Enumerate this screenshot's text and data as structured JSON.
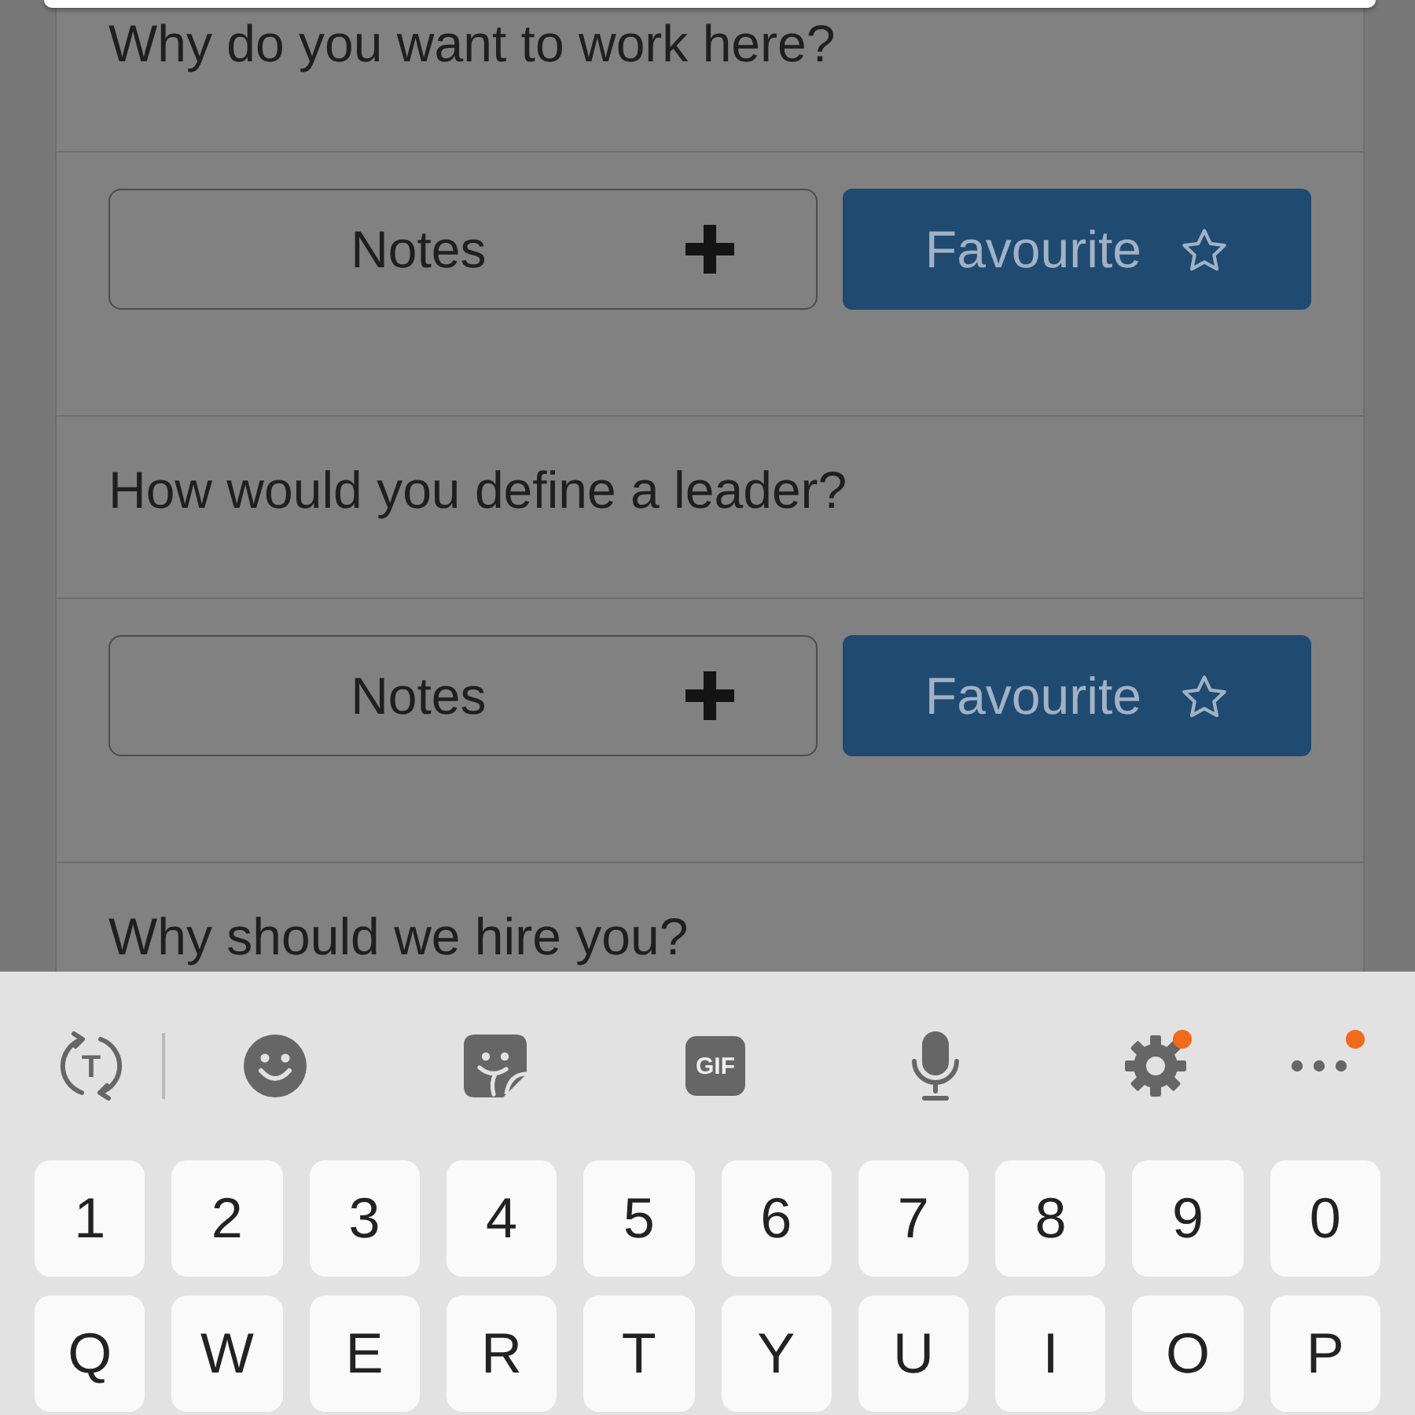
{
  "dialog": {
    "open": true
  },
  "questions": [
    {
      "text": "Why do you want to work here?",
      "notes_button": {
        "label": "Notes"
      },
      "favourite_button": {
        "label": "Favourite",
        "favourited": false
      }
    },
    {
      "text": "How would you define a leader?",
      "notes_button": {
        "label": "Notes"
      },
      "favourite_button": {
        "label": "Favourite",
        "favourited": false
      }
    },
    {
      "text": "Why should we hire you?"
    }
  ],
  "keyboard": {
    "toolbar": [
      {
        "kind": "translate",
        "label": "T",
        "badge": false
      },
      {
        "kind": "divider"
      },
      {
        "kind": "emoji",
        "badge": false
      },
      {
        "kind": "sticker",
        "badge": false
      },
      {
        "kind": "gif",
        "label": "GIF",
        "badge": false
      },
      {
        "kind": "mic",
        "badge": false
      },
      {
        "kind": "settings",
        "badge": true
      },
      {
        "kind": "more",
        "badge": true
      }
    ],
    "rows": [
      [
        "1",
        "2",
        "3",
        "4",
        "5",
        "6",
        "7",
        "8",
        "9",
        "0"
      ],
      [
        "Q",
        "W",
        "E",
        "R",
        "T",
        "Y",
        "U",
        "I",
        "O",
        "P"
      ]
    ]
  }
}
